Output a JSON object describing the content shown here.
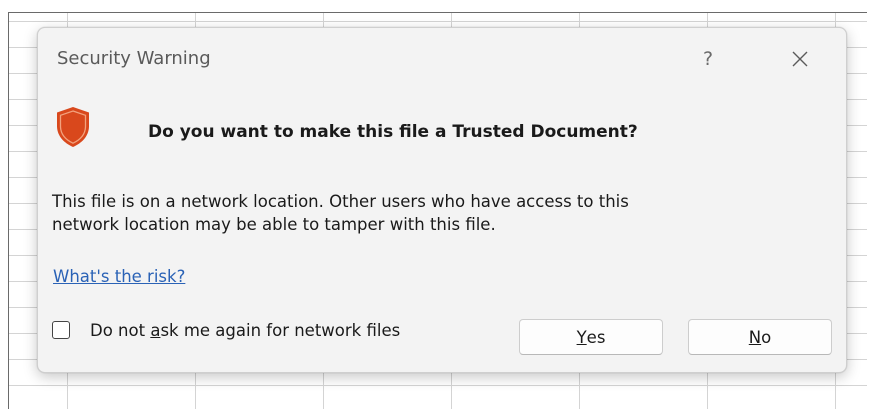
{
  "dialog": {
    "title": "Security Warning",
    "help_label": "?",
    "question": "Do you want to make this file a Trusted Document?",
    "message_lines": [
      "This file is on a network location. Other users who have access to this",
      "network location may be able to tamper with this file."
    ],
    "risk_link": "What's the risk?",
    "checkbox": {
      "label_before": "Do not ",
      "label_mnemonic": "a",
      "label_after": "sk me again for network files",
      "checked": false
    },
    "buttons": {
      "yes": {
        "mnemonic": "Y",
        "rest": "es"
      },
      "no": {
        "mnemonic": "N",
        "rest": "o"
      }
    },
    "icons": {
      "shield": "shield-icon",
      "close": "close-icon",
      "help": "help-icon"
    },
    "colors": {
      "shield_fill": "#d9481c",
      "shield_inner": "#e2582a",
      "link": "#2a62b6",
      "dialog_bg": "#f3f3f3"
    }
  }
}
